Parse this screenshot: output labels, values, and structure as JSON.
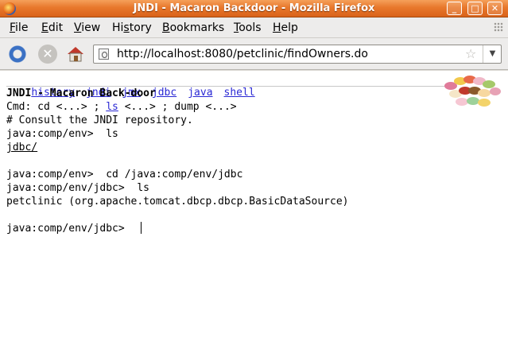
{
  "window": {
    "title": "JNDI - Macaron Backdoor - Mozilla Firefox",
    "min_glyph": "_",
    "max_glyph": "□",
    "close_glyph": "✕"
  },
  "menu": [
    "File",
    "Edit",
    "View",
    "History",
    "Bookmarks",
    "Tools",
    "Help"
  ],
  "menu_mnemonics": [
    "F",
    "E",
    "V",
    "s",
    "B",
    "T",
    "H"
  ],
  "toolbar": {
    "url": "http://localhost:8080/petclinic/findOwners.do",
    "star_glyph": "☆",
    "dropdown_glyph": "▼"
  },
  "page": {
    "nav_links": [
      "history",
      "jndi",
      "jmx",
      "jdbc",
      "java",
      "shell"
    ],
    "heading": "JNDI - Macaron Back-door",
    "cmd_prefix": "Cmd: cd <...> ; ",
    "cmd_ls": "ls",
    "cmd_suffix": " <...> ; dump <...>",
    "comment": "# Consult the JNDI repository.",
    "lines": [
      "java:comp/env>  ls",
      "java:comp/env>  cd /java:comp/env/jdbc",
      "java:comp/env/jdbc>  ls",
      "petclinic (org.apache.tomcat.dbcp.dbcp.BasicDataSource)",
      "java:comp/env/jdbc>  "
    ],
    "dir_link": "jdbc/"
  },
  "colors": {
    "link": "#2a28d4",
    "titlebar": "#e8782c"
  }
}
